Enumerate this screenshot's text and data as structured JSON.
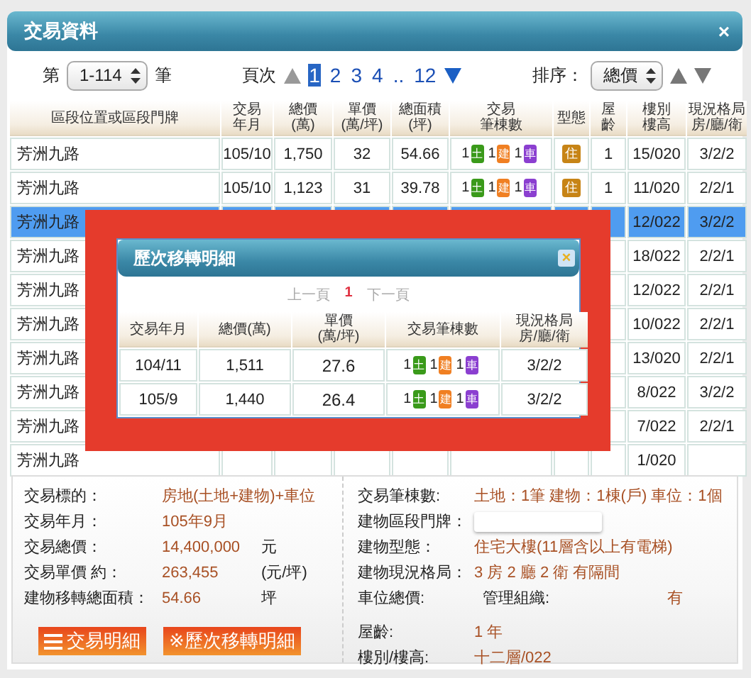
{
  "window": {
    "title": "交易資料",
    "close": "×"
  },
  "controls": {
    "range_prefix": "第",
    "range_select": "1-114",
    "range_suffix": "筆",
    "page_label": "頁次",
    "pages": [
      {
        "label": "1",
        "selected": true
      },
      {
        "label": "2",
        "selected": false
      },
      {
        "label": "3",
        "selected": false
      },
      {
        "label": "4",
        "selected": false
      },
      {
        "label": "..",
        "selected": false
      },
      {
        "label": "12",
        "selected": false
      }
    ],
    "sort_label": "排序：",
    "sort_select": "總價"
  },
  "table": {
    "columns": [
      [
        "區段位置或區段門牌"
      ],
      [
        "交易",
        "年月"
      ],
      [
        "總價",
        "(萬)"
      ],
      [
        "單價",
        "(萬/坪)"
      ],
      [
        "總面積",
        "(坪)"
      ],
      [
        "交易",
        "筆棟數"
      ],
      [
        "型態"
      ],
      [
        "屋",
        "齡"
      ],
      [
        "樓別",
        "樓高"
      ],
      [
        "現況格局",
        "房/廳/衛"
      ]
    ],
    "rows": [
      {
        "address": "芳洲九路",
        "date": "105/10",
        "total": "1,750",
        "unit": "32",
        "area": "54.66",
        "counts": [
          {
            "count": "1",
            "label": "土",
            "color": "#3a9a1a"
          },
          {
            "count": "1",
            "label": "建",
            "color": "#f07f22"
          },
          {
            "count": "1",
            "label": "車",
            "color": "#8b3fd0"
          }
        ],
        "type": "住",
        "age": "1",
        "floor": "15/020",
        "layout": "3/2/2",
        "selected": false
      },
      {
        "address": "芳洲九路",
        "date": "105/10",
        "total": "1,123",
        "unit": "31",
        "area": "39.78",
        "counts": [
          {
            "count": "1",
            "label": "土",
            "color": "#3a9a1a"
          },
          {
            "count": "1",
            "label": "建",
            "color": "#f07f22"
          },
          {
            "count": "1",
            "label": "車",
            "color": "#8b3fd0"
          }
        ],
        "type": "住",
        "age": "1",
        "floor": "11/020",
        "layout": "2/2/1",
        "selected": false
      },
      {
        "address": "芳洲九路",
        "floor": "12/022",
        "layout": "3/2/2",
        "selected": true
      },
      {
        "address": "芳洲九路",
        "floor": "18/022",
        "layout": "2/2/1",
        "selected": false
      },
      {
        "address": "芳洲九路",
        "floor": "12/022",
        "layout": "2/2/1",
        "selected": false
      },
      {
        "address": "芳洲九路",
        "floor": "10/022",
        "layout": "2/2/1",
        "selected": false
      },
      {
        "address": "芳洲九路",
        "floor": "13/020",
        "layout": "2/2/1",
        "selected": false
      },
      {
        "address": "芳洲九路",
        "floor": "8/022",
        "layout": "3/2/2",
        "selected": false
      },
      {
        "address": "芳洲九路",
        "floor": "7/022",
        "layout": "2/2/1",
        "selected": false
      },
      {
        "address": "芳洲九路",
        "floor": "1/020",
        "selected": false
      }
    ]
  },
  "details": {
    "left": [
      {
        "label": "交易標的：",
        "value": "房地(土地+建物)+車位"
      },
      {
        "label": "交易年月：",
        "value": "105年9月"
      },
      {
        "label": "交易總價：",
        "value": "14,400,000",
        "unit": "元"
      },
      {
        "label": "交易單價 約：",
        "value": "263,455",
        "unit": "(元/坪)"
      },
      {
        "label": "建物移轉總面積：",
        "value": "54.66",
        "unit": "坪"
      }
    ],
    "buttons": [
      {
        "label": "交易明細",
        "kind": "list"
      },
      {
        "label": "※歷次移轉明細",
        "kind": "plain"
      }
    ],
    "right": [
      {
        "label": "交易筆棟數:",
        "value": "土地：1筆 建物：1棟(戶) 車位：1個",
        "kind": "text"
      },
      {
        "label": "建物區段門牌：",
        "kind": "field"
      },
      {
        "label": "建物型態：",
        "value": "住宅大樓(11層含以上有電梯)",
        "kind": "text"
      },
      {
        "label": "建物現況格局：",
        "value": "3 房 2 廳 2 衛 有隔間",
        "kind": "text"
      },
      {
        "label": "車位總價:",
        "sublabel": "管理組織:",
        "value": "有",
        "kind": "pair"
      },
      {
        "label": "屋齡:",
        "value": "1  年",
        "kind": "text"
      },
      {
        "label": "樓別/樓高:",
        "value": "十二層/022",
        "kind": "text"
      }
    ]
  },
  "popup": {
    "title": "歷次移轉明細",
    "close": "×",
    "pager": {
      "prev": "上一頁",
      "current": "1",
      "next": "下一頁"
    },
    "columns": [
      [
        "交易年月"
      ],
      [
        "總價(萬)"
      ],
      [
        "單價",
        "(萬/坪)"
      ],
      [
        "交易筆棟數"
      ],
      [
        "現況格局",
        "房/廳/衛"
      ]
    ],
    "rows": [
      {
        "date": "104/11",
        "total": "1,511",
        "unit": "27.6",
        "counts": [
          {
            "count": "1",
            "label": "土",
            "color": "#3a9a1a"
          },
          {
            "count": "1",
            "label": "建",
            "color": "#f07f22"
          },
          {
            "count": "1",
            "label": "車",
            "color": "#8b3fd0"
          }
        ],
        "layout": "3/2/2"
      },
      {
        "date": "105/9",
        "total": "1,440",
        "unit": "26.4",
        "counts": [
          {
            "count": "1",
            "label": "土",
            "color": "#3a9a1a"
          },
          {
            "count": "1",
            "label": "建",
            "color": "#f07f22"
          },
          {
            "count": "1",
            "label": "車",
            "color": "#8b3fd0"
          }
        ],
        "layout": "3/2/2"
      }
    ]
  }
}
